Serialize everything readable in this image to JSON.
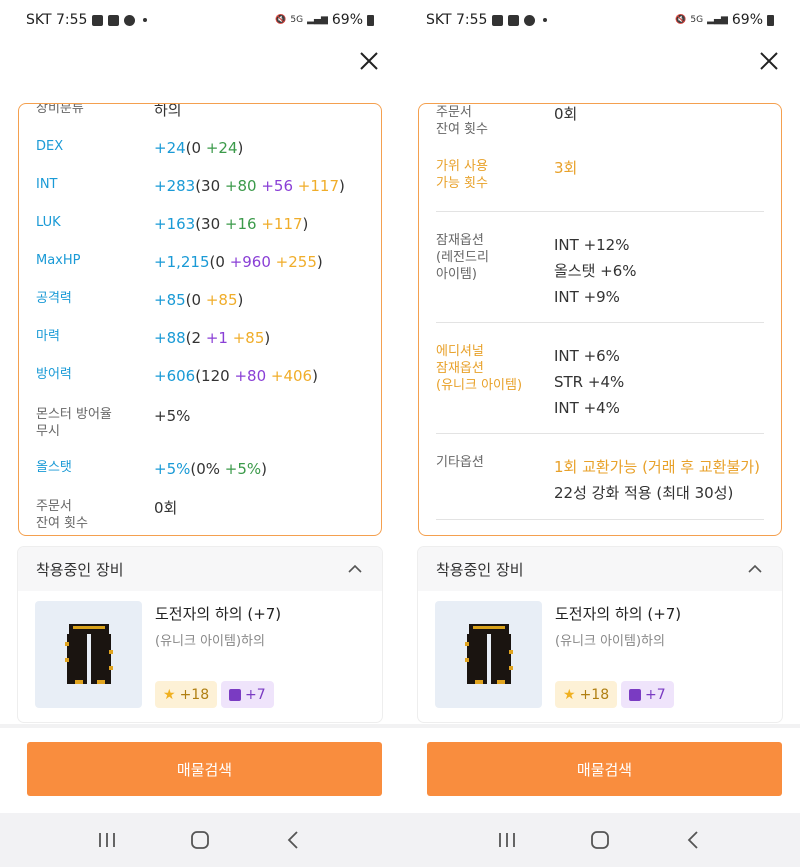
{
  "status": {
    "carrier_time": "SKT 7:55",
    "battery": "69%",
    "network": "5G"
  },
  "colors": {
    "accent_orange": "#f98d3e",
    "border_orange": "#f4a04f",
    "stat_blue": "#1a9ad6",
    "green": "#3b9a4a",
    "purple": "#8a3fd6",
    "gold": "#f0ad2a"
  },
  "left": {
    "stats": [
      {
        "label": "장비분류",
        "value": "하의"
      },
      {
        "label": "DEX",
        "total": "+24",
        "open": "(0 ",
        "add": "+24",
        "close": ")"
      },
      {
        "label": "INT",
        "total": "+283",
        "open": "(30 ",
        "add": "+80",
        "scroll": " +56",
        "star": " +117",
        "close": ")"
      },
      {
        "label": "LUK",
        "total": "+163",
        "open": "(30 ",
        "add": "+16",
        "star": " +117",
        "close": ")"
      },
      {
        "label": "MaxHP",
        "total": "+1,215",
        "open": "(0 ",
        "add": "+960",
        "star": " +255",
        "close": ")"
      },
      {
        "label": "공격력",
        "total": "+85",
        "open": "(0 ",
        "star": "+85",
        "close": ")"
      },
      {
        "label": "마력",
        "total": "+88",
        "open": "(2 ",
        "scroll": "+1",
        "star": " +85",
        "close": ")"
      },
      {
        "label": "방어력",
        "total": "+606",
        "open": "(120 ",
        "scroll": "+80",
        "star": " +406",
        "close": ")"
      },
      {
        "label1": "몬스터 방어율",
        "label2": "무시",
        "value": "+5%"
      },
      {
        "label": "올스탯",
        "total": "+5%",
        "open": "(0% ",
        "add": "+5%",
        "close": ")"
      },
      {
        "label1": "주문서",
        "label2": "잔여 횟수",
        "value": "0회"
      }
    ]
  },
  "right": {
    "scroll_label1": "주문서",
    "scroll_label2": "잔여 횟수",
    "scroll_value": "0회",
    "scissors_label1": "가위 사용",
    "scissors_label2": "가능 횟수",
    "scissors_value": "3회",
    "potential_label1": "잠재옵션",
    "potential_label2": "(레전드리",
    "potential_label3": "아이템)",
    "potential_lines": [
      "INT +12%",
      "올스탯 +6%",
      "INT +9%"
    ],
    "additional_label1": "에디셔널",
    "additional_label2": "잠재옵션",
    "additional_label3": "(유니크 아이템)",
    "additional_lines": [
      "INT +6%",
      "STR +4%",
      "INT +4%"
    ],
    "etc_label": "기타옵션",
    "etc_line1": "1회 교환가능 (거래 후 교환불가)",
    "etc_line2": "22성 강화 적용 (최대 30성)"
  },
  "equip": {
    "header": "착용중인 장비",
    "item_name": "도전자의 하의 (+7)",
    "item_type": "(유니크 아이템)하의",
    "star_badge": "+18",
    "scroll_badge": "+7"
  },
  "search_button": "매물검색"
}
